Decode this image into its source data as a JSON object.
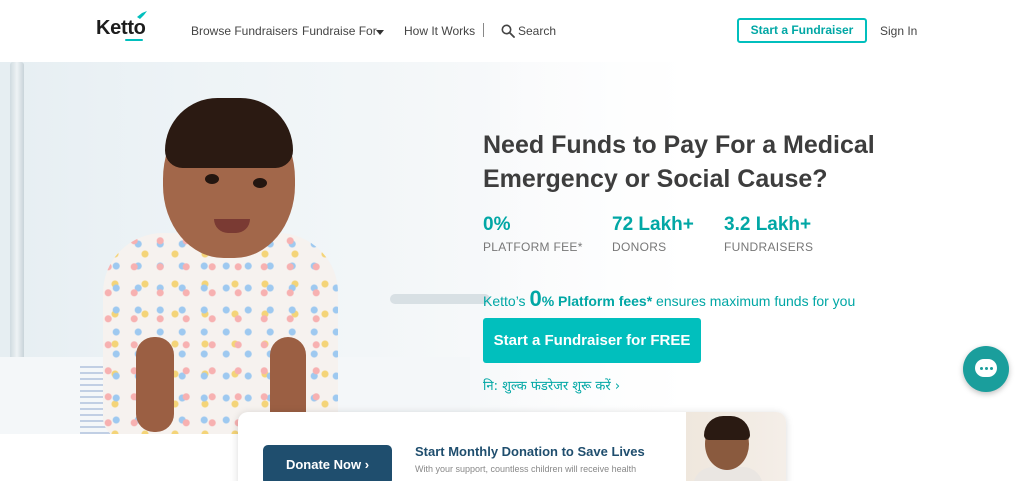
{
  "header": {
    "logo": "Ketto",
    "nav": {
      "browse": "Browse Fundraisers",
      "fundraise_for": "Fundraise For",
      "how_it_works": "How It Works",
      "search": "Search"
    },
    "start_fundraiser": "Start a Fundraiser",
    "sign_in": "Sign In"
  },
  "hero": {
    "headline": "Need Funds to Pay For a Medical Emergency or Social Cause?",
    "stats": [
      {
        "value": "0%",
        "label": "PLATFORM FEE*"
      },
      {
        "value": "72 Lakh+",
        "label": "DONORS"
      },
      {
        "value": "3.2 Lakh+",
        "label": "FUNDRAISERS"
      }
    ],
    "fee_line": {
      "prefix": "Ketto’s ",
      "big": "0",
      "bold": "% Platform fees*",
      "suffix": " ensures maximum funds for you"
    },
    "cta": "Start a Fundraiser for FREE",
    "hindi_cta": "नि: शुल्क फंडरेजर शुरू करें",
    "hindi_chevron": "›"
  },
  "monthly_card": {
    "donate_button": "Donate Now",
    "donate_chevron": "›",
    "title": "Start Monthly Donation to Save Lives",
    "subtitle": "With your support, countless children will receive health"
  },
  "colors": {
    "accent": "#01bfbd",
    "accent_text": "#01a7a5",
    "navy": "#1f4e6e"
  }
}
